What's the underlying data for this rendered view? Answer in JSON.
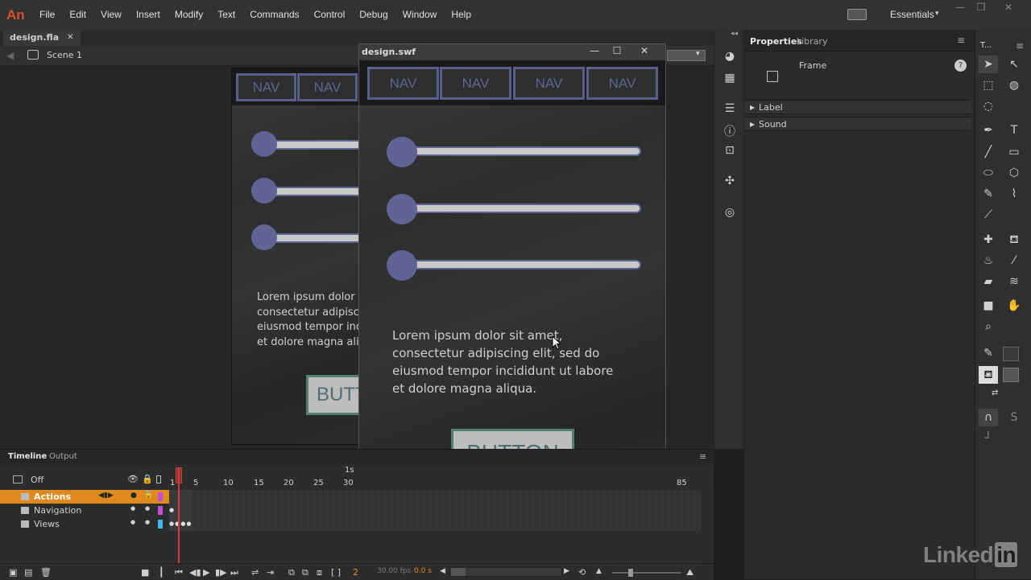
{
  "app": {
    "logo": "An",
    "menu": [
      "File",
      "Edit",
      "View",
      "Insert",
      "Modify",
      "Text",
      "Commands",
      "Control",
      "Debug",
      "Window",
      "Help"
    ],
    "workspace": "Essentials"
  },
  "document": {
    "tab_name": "design.fla",
    "scene": "Scene 1"
  },
  "stage": {
    "nav_labels": [
      "NAV",
      "NAV"
    ],
    "lorem_lines": [
      "Lorem ipsum dolor",
      "consectetur adipisc",
      "eiusmod tempor inc",
      "et dolore magna ali"
    ],
    "button_label": "BUTT"
  },
  "swf": {
    "title": "design.swf",
    "nav_labels": [
      "NAV",
      "NAV",
      "NAV",
      "NAV"
    ],
    "slider_count": 3,
    "lorem_lines": [
      "Lorem ipsum dolor sit amet,",
      "consectetur adipiscing elit, sed do",
      "eiusmod tempor incididunt ut labore",
      "et dolore magna aliqua."
    ],
    "button_label": "BUTTON"
  },
  "properties": {
    "tabs": [
      "Properties",
      "Library"
    ],
    "type": "Frame",
    "sections": [
      "Label",
      "Sound"
    ]
  },
  "tools_header": "T...",
  "timeline": {
    "tabs": [
      "Timeline",
      "Output"
    ],
    "off_label": "Off",
    "layers": [
      {
        "name": "Actions",
        "color": "#c34fd8",
        "selected": true
      },
      {
        "name": "Navigation",
        "color": "#c34fd8",
        "selected": false
      },
      {
        "name": "Views",
        "color": "#3db8e8",
        "selected": false
      }
    ],
    "frame_numbers": [
      "1",
      "5",
      "10",
      "15",
      "20",
      "25",
      "30",
      "85"
    ],
    "second_marker": "1s",
    "current_frame": "2",
    "fps": "30.00 fps",
    "elapsed": "0.0 s"
  },
  "watermark": {
    "text": "Linked",
    "in": "in"
  },
  "colors": {
    "accent": "#d94f2b",
    "nav": "#5f6494",
    "button_border": "#4f8272",
    "layer_selected": "#e08a1e"
  }
}
